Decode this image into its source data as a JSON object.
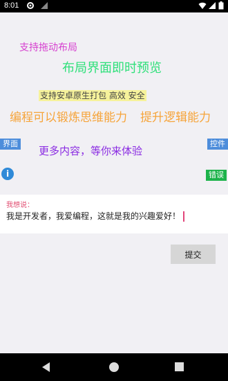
{
  "status": {
    "time": "8:01"
  },
  "content": {
    "line1": "支持拖动布局",
    "line2": "布局界面即时预览",
    "line3": "支持安卓原生打包  高效  安全",
    "line4a": "编程可以锻炼思维能力",
    "line4b": "提升逻辑能力",
    "line5": "更多内容，等你来体验"
  },
  "tags": {
    "left": "界面",
    "right": "控件",
    "error": "错误"
  },
  "info": {
    "glyph": "i"
  },
  "comment": {
    "label": "我想说：",
    "value": "我是开发者，我爱编程，这就是我的兴趣爱好！"
  },
  "submit": {
    "label": "提交"
  },
  "colors": {
    "status_bar": "#000000",
    "nav_bar": "#000000",
    "submit_button": "#d6d6d6"
  }
}
